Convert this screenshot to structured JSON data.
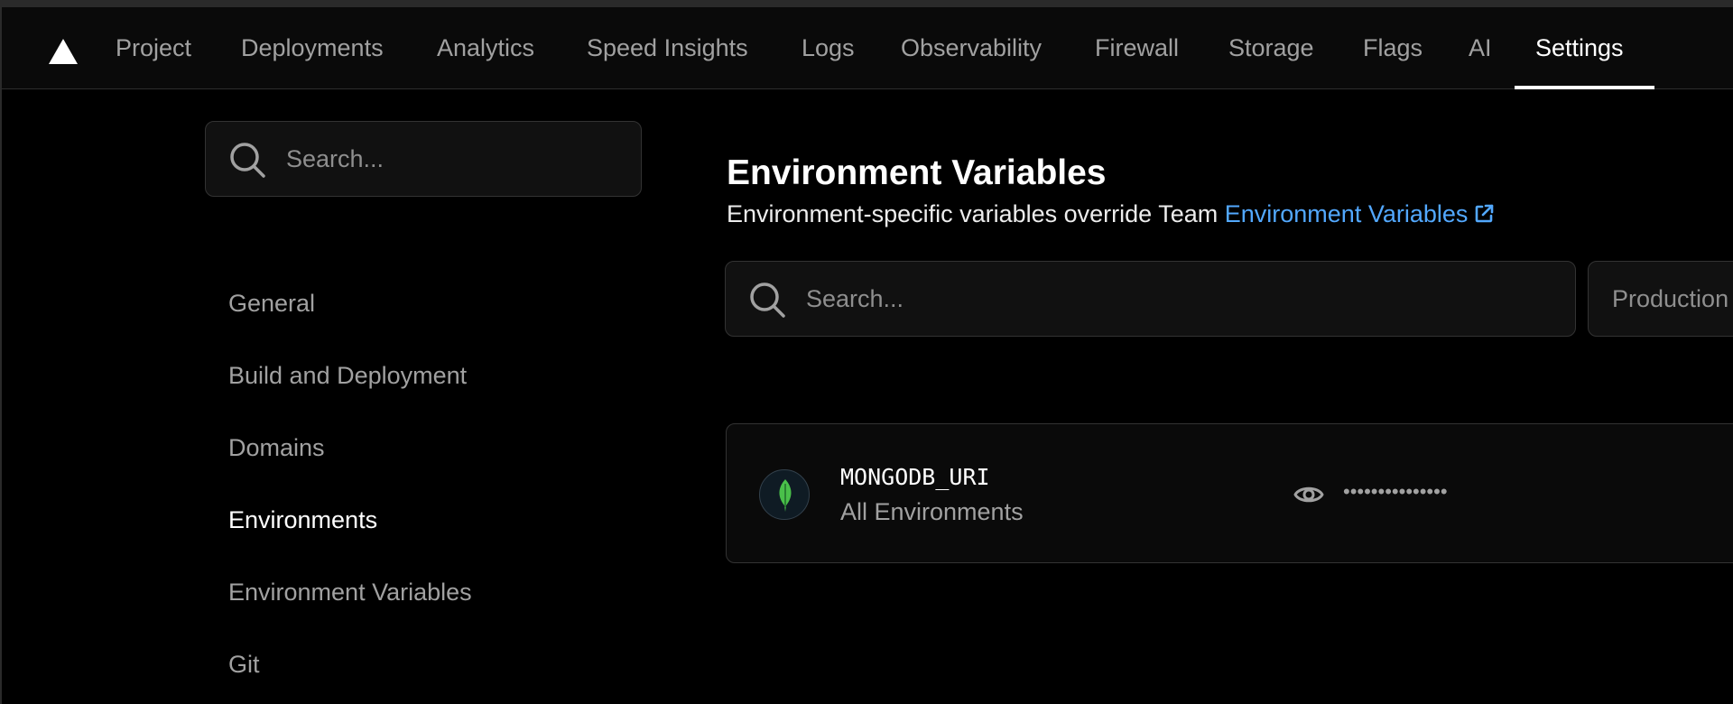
{
  "nav": {
    "tabs": [
      {
        "label": "Project"
      },
      {
        "label": "Deployments"
      },
      {
        "label": "Analytics"
      },
      {
        "label": "Speed Insights"
      },
      {
        "label": "Logs"
      },
      {
        "label": "Observability"
      },
      {
        "label": "Firewall"
      },
      {
        "label": "Storage"
      },
      {
        "label": "Flags"
      },
      {
        "label": "AI"
      },
      {
        "label": "Settings"
      }
    ],
    "active_tab": "Settings"
  },
  "sidebar": {
    "search_placeholder": "Search...",
    "items": [
      {
        "label": "General"
      },
      {
        "label": "Build and Deployment"
      },
      {
        "label": "Domains"
      },
      {
        "label": "Environments"
      },
      {
        "label": "Environment Variables"
      },
      {
        "label": "Git"
      }
    ],
    "active_item": "Environments"
  },
  "main": {
    "title": "Environment Variables",
    "subtitle_prefix": "Environment-specific variables override Team",
    "subtitle_link": "Environment Variables",
    "search_placeholder": "Search...",
    "environment_filter": "Production",
    "variables": [
      {
        "name": "MONGODB_URI",
        "scope": "All Environments",
        "masked_value": "•••••••••••••••"
      }
    ]
  },
  "colors": {
    "background": "#000000",
    "link": "#52a8ff",
    "mongodb_leaf": "#4ac04a",
    "active_text": "#ffffff",
    "muted_text": "#a1a1a1"
  },
  "icons": [
    "triangle-logo-icon",
    "search-icon",
    "external-link-icon",
    "mongodb-leaf-icon",
    "eye-icon"
  ]
}
